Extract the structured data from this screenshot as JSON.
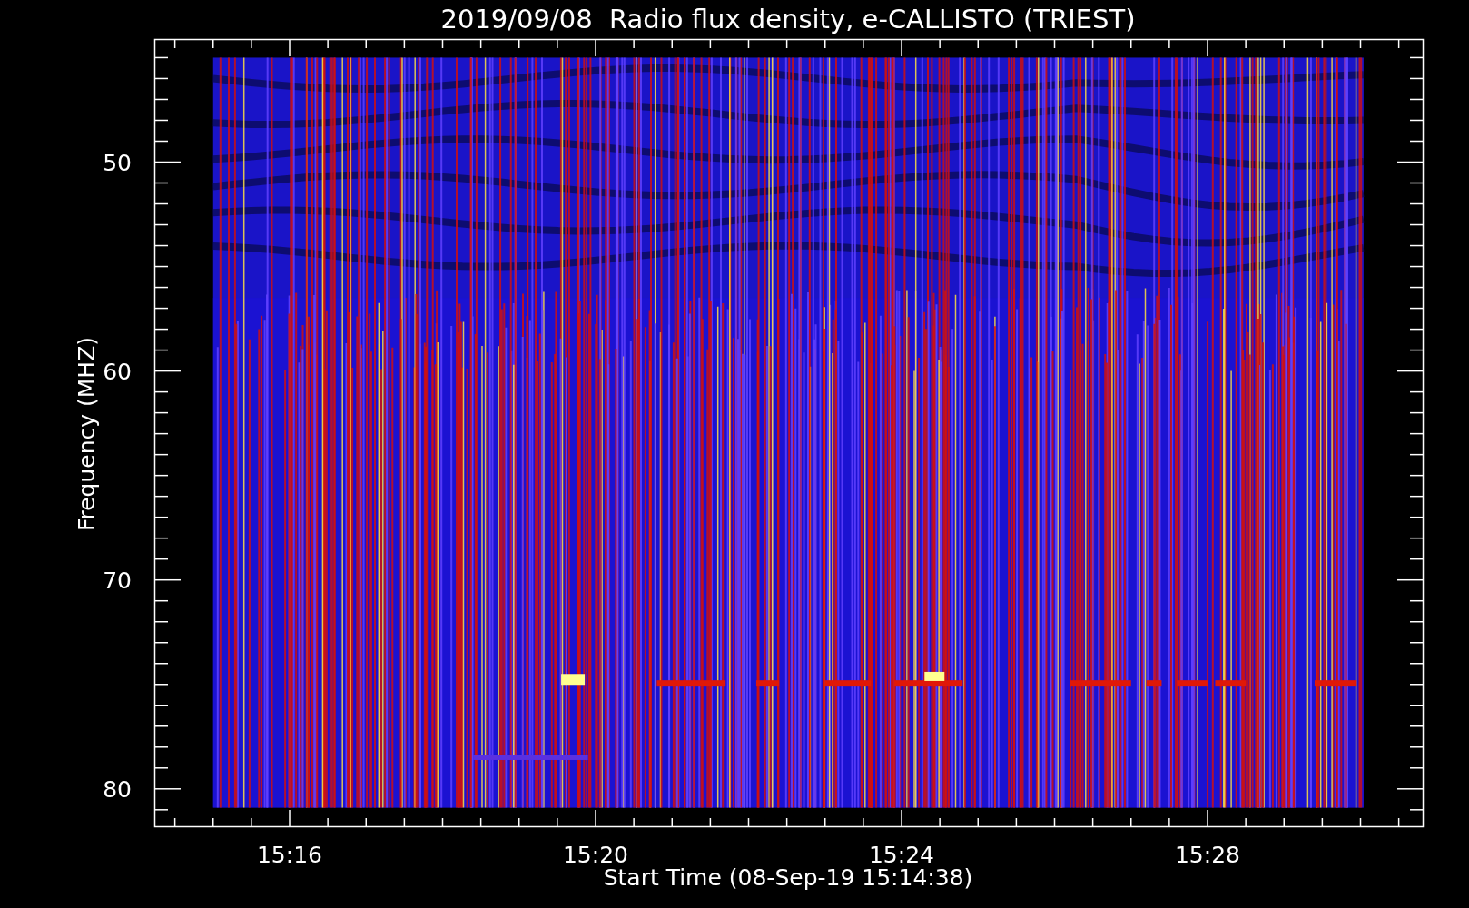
{
  "plot": {
    "title": "2019/09/08  Radio flux density, e-CALLISTO (TRIEST)",
    "xlabel": "Start Time (08-Sep-19 15:14:38)",
    "ylabel": "Frequency (MHZ)",
    "x_tick_labels": [
      "15:16",
      "15:20",
      "15:24",
      "15:28"
    ],
    "y_tick_labels": [
      "50",
      "60",
      "70",
      "80"
    ]
  }
}
